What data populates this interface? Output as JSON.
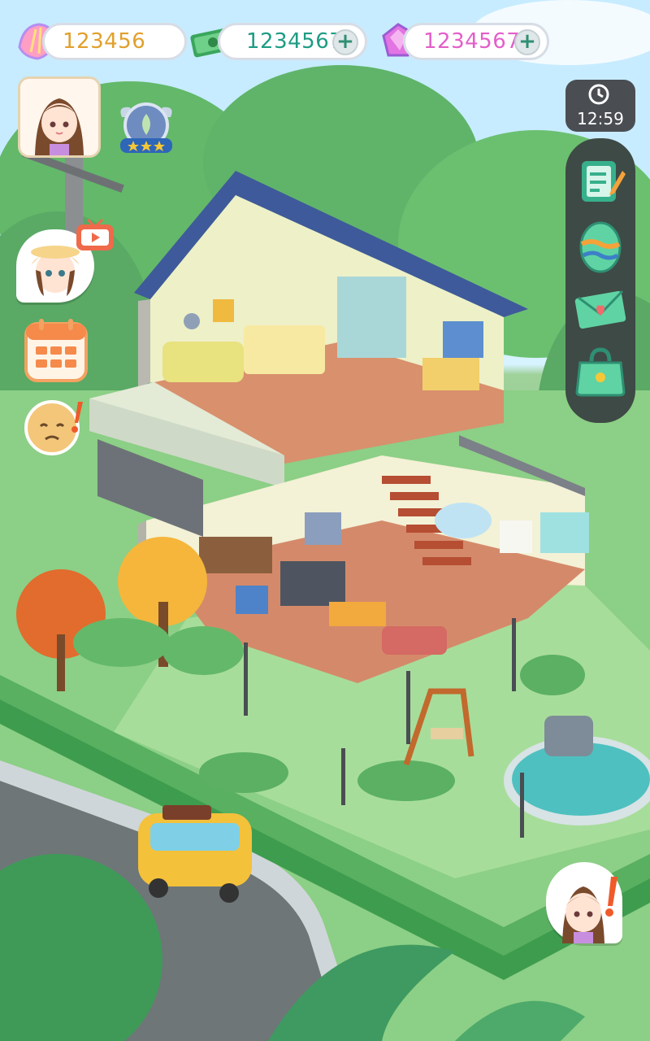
{
  "currency": {
    "shells": {
      "value": "123456",
      "icon": "shell-icon",
      "color": "#e1a02c"
    },
    "cash": {
      "value": "1234567",
      "icon": "cash-icon",
      "color": "#1e9c84"
    },
    "gems": {
      "value": "1234567",
      "icon": "gem-icon",
      "color": "#e35fc9"
    }
  },
  "timer": {
    "time": "12:59",
    "icon": "clock-icon"
  },
  "colors": {
    "panel": "#3e4a45",
    "grass": "#8fd08a",
    "roof": "#3f5a9a",
    "floor": "#d48a6a"
  },
  "right_menu": [
    {
      "icon": "task-list-icon"
    },
    {
      "icon": "egg-icon"
    },
    {
      "icon": "mail-icon"
    },
    {
      "icon": "bag-icon"
    }
  ],
  "left_menu": [
    {
      "icon": "player-avatar-icon"
    },
    {
      "icon": "level-badge-icon",
      "stars": 3
    },
    {
      "icon": "video-ad-icon"
    },
    {
      "icon": "calendar-icon"
    },
    {
      "icon": "sad-face-alert-icon"
    }
  ],
  "npc_alert": {
    "icon": "npc-alert-icon"
  }
}
